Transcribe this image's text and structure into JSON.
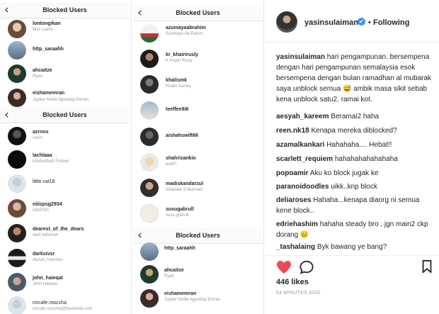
{
  "panel_a": {
    "title": "Blocked Users",
    "rows": [
      {
        "username": "lontongikan",
        "fullname": "Blar Laahh"
      },
      {
        "username": "http_saraahh",
        "fullname": ""
      },
      {
        "username": "ahcaitze",
        "fullname": "Ryan"
      },
      {
        "username": "eishamemran",
        "fullname": "Jupiter Nollie Agunday Emran"
      }
    ]
  },
  "panel_b": {
    "title": "Blocked Users",
    "rows": [
      {
        "username": "azrnnx",
        "fullname": "Azrin"
      },
      {
        "username": "lachlaaa",
        "fullname": "infofootball/ Follow!"
      },
      {
        "username": "little.cat18",
        "fullname": ""
      },
      {
        "username": "niiizpsg2934",
        "fullname": "niiizPSG"
      },
      {
        "username": "dearest_of_the_dears",
        "fullname": "Ibeh fathimah"
      },
      {
        "username": "darksivsr",
        "fullname": "Akmal_Hamdan"
      },
      {
        "username": "john_haieqal",
        "fullname": "John Haieqal"
      },
      {
        "username": "mrcafe.moccha",
        "fullname": "mrcafe.moccha@facebook.com"
      }
    ]
  },
  "panel_c": {
    "title": "Blocked Users",
    "rows": [
      {
        "username": "azumayaabrahim",
        "fullname": "Azumaya Ab Rahim"
      },
      {
        "username": "kr_khairirusly",
        "fullname": "K Khairi Rusly"
      },
      {
        "username": "khalismk",
        "fullname": "Khalis Kardry"
      },
      {
        "username": "teeffee8i8",
        "fullname": ""
      },
      {
        "username": "aishahswift68",
        "fullname": ""
      },
      {
        "username": "shahrizankio",
        "fullname": "wolli!!"
      },
      {
        "username": "madiskandarzul",
        "fullname": "Iskandar Zulkarnain"
      },
      {
        "username": "susugabrull",
        "fullname": "susu gobrull"
      }
    ]
  },
  "panel_d": {
    "title": "Blocked Users",
    "rows": [
      {
        "username": "http_saraahh",
        "fullname": ""
      },
      {
        "username": "ahcaitze",
        "fullname": "Ryan"
      },
      {
        "username": "eishamemran",
        "fullname": "Jupiter Nollie Agunday Emran"
      }
    ]
  },
  "post": {
    "owner": "yasinsulaiman",
    "verified_mark": "✔",
    "dot": "•",
    "follow_label": "Following",
    "caption_user": "yasinsulaiman",
    "caption_text": "hari pengampunan. bersempena dengan hari pengampunan semalaysia esok bersempena dengan bulan ramadhan al mubarak saya unblock semua 😅 ambik masa sikit sebab kena unblock satu2. ramai kot.",
    "comments": [
      {
        "user": "aesyah_kareem",
        "text": "Beramai2 haha"
      },
      {
        "user": "reen.nk18",
        "text": "Kenapa mereka diblocked?"
      },
      {
        "user": "azamalkankari",
        "text": "Hahahaha.... Hebat!!"
      },
      {
        "user": "scarlett_requiem",
        "text": "hahahahahahahaha"
      },
      {
        "user": "popoamir",
        "text": "Aku ko block jugak ke"
      },
      {
        "user": "paranoidoodles",
        "text": "uikk..knp block"
      },
      {
        "user": "deliaroses",
        "text": "Hahaha...kenapa diaorg ni semua kene block.."
      },
      {
        "user": "edriehashim",
        "text": "hahaha steady bro , jgn main2 ckp dorang 😐"
      },
      {
        "user": "_tashalaing",
        "text": "Byk bawang ye bang?"
      }
    ],
    "likes": "446 likes",
    "time_ago": "54 MINUTES AGO"
  },
  "colors": {
    "heart": "#ed4956",
    "verified": "#3897f0",
    "muted": "#999999"
  }
}
